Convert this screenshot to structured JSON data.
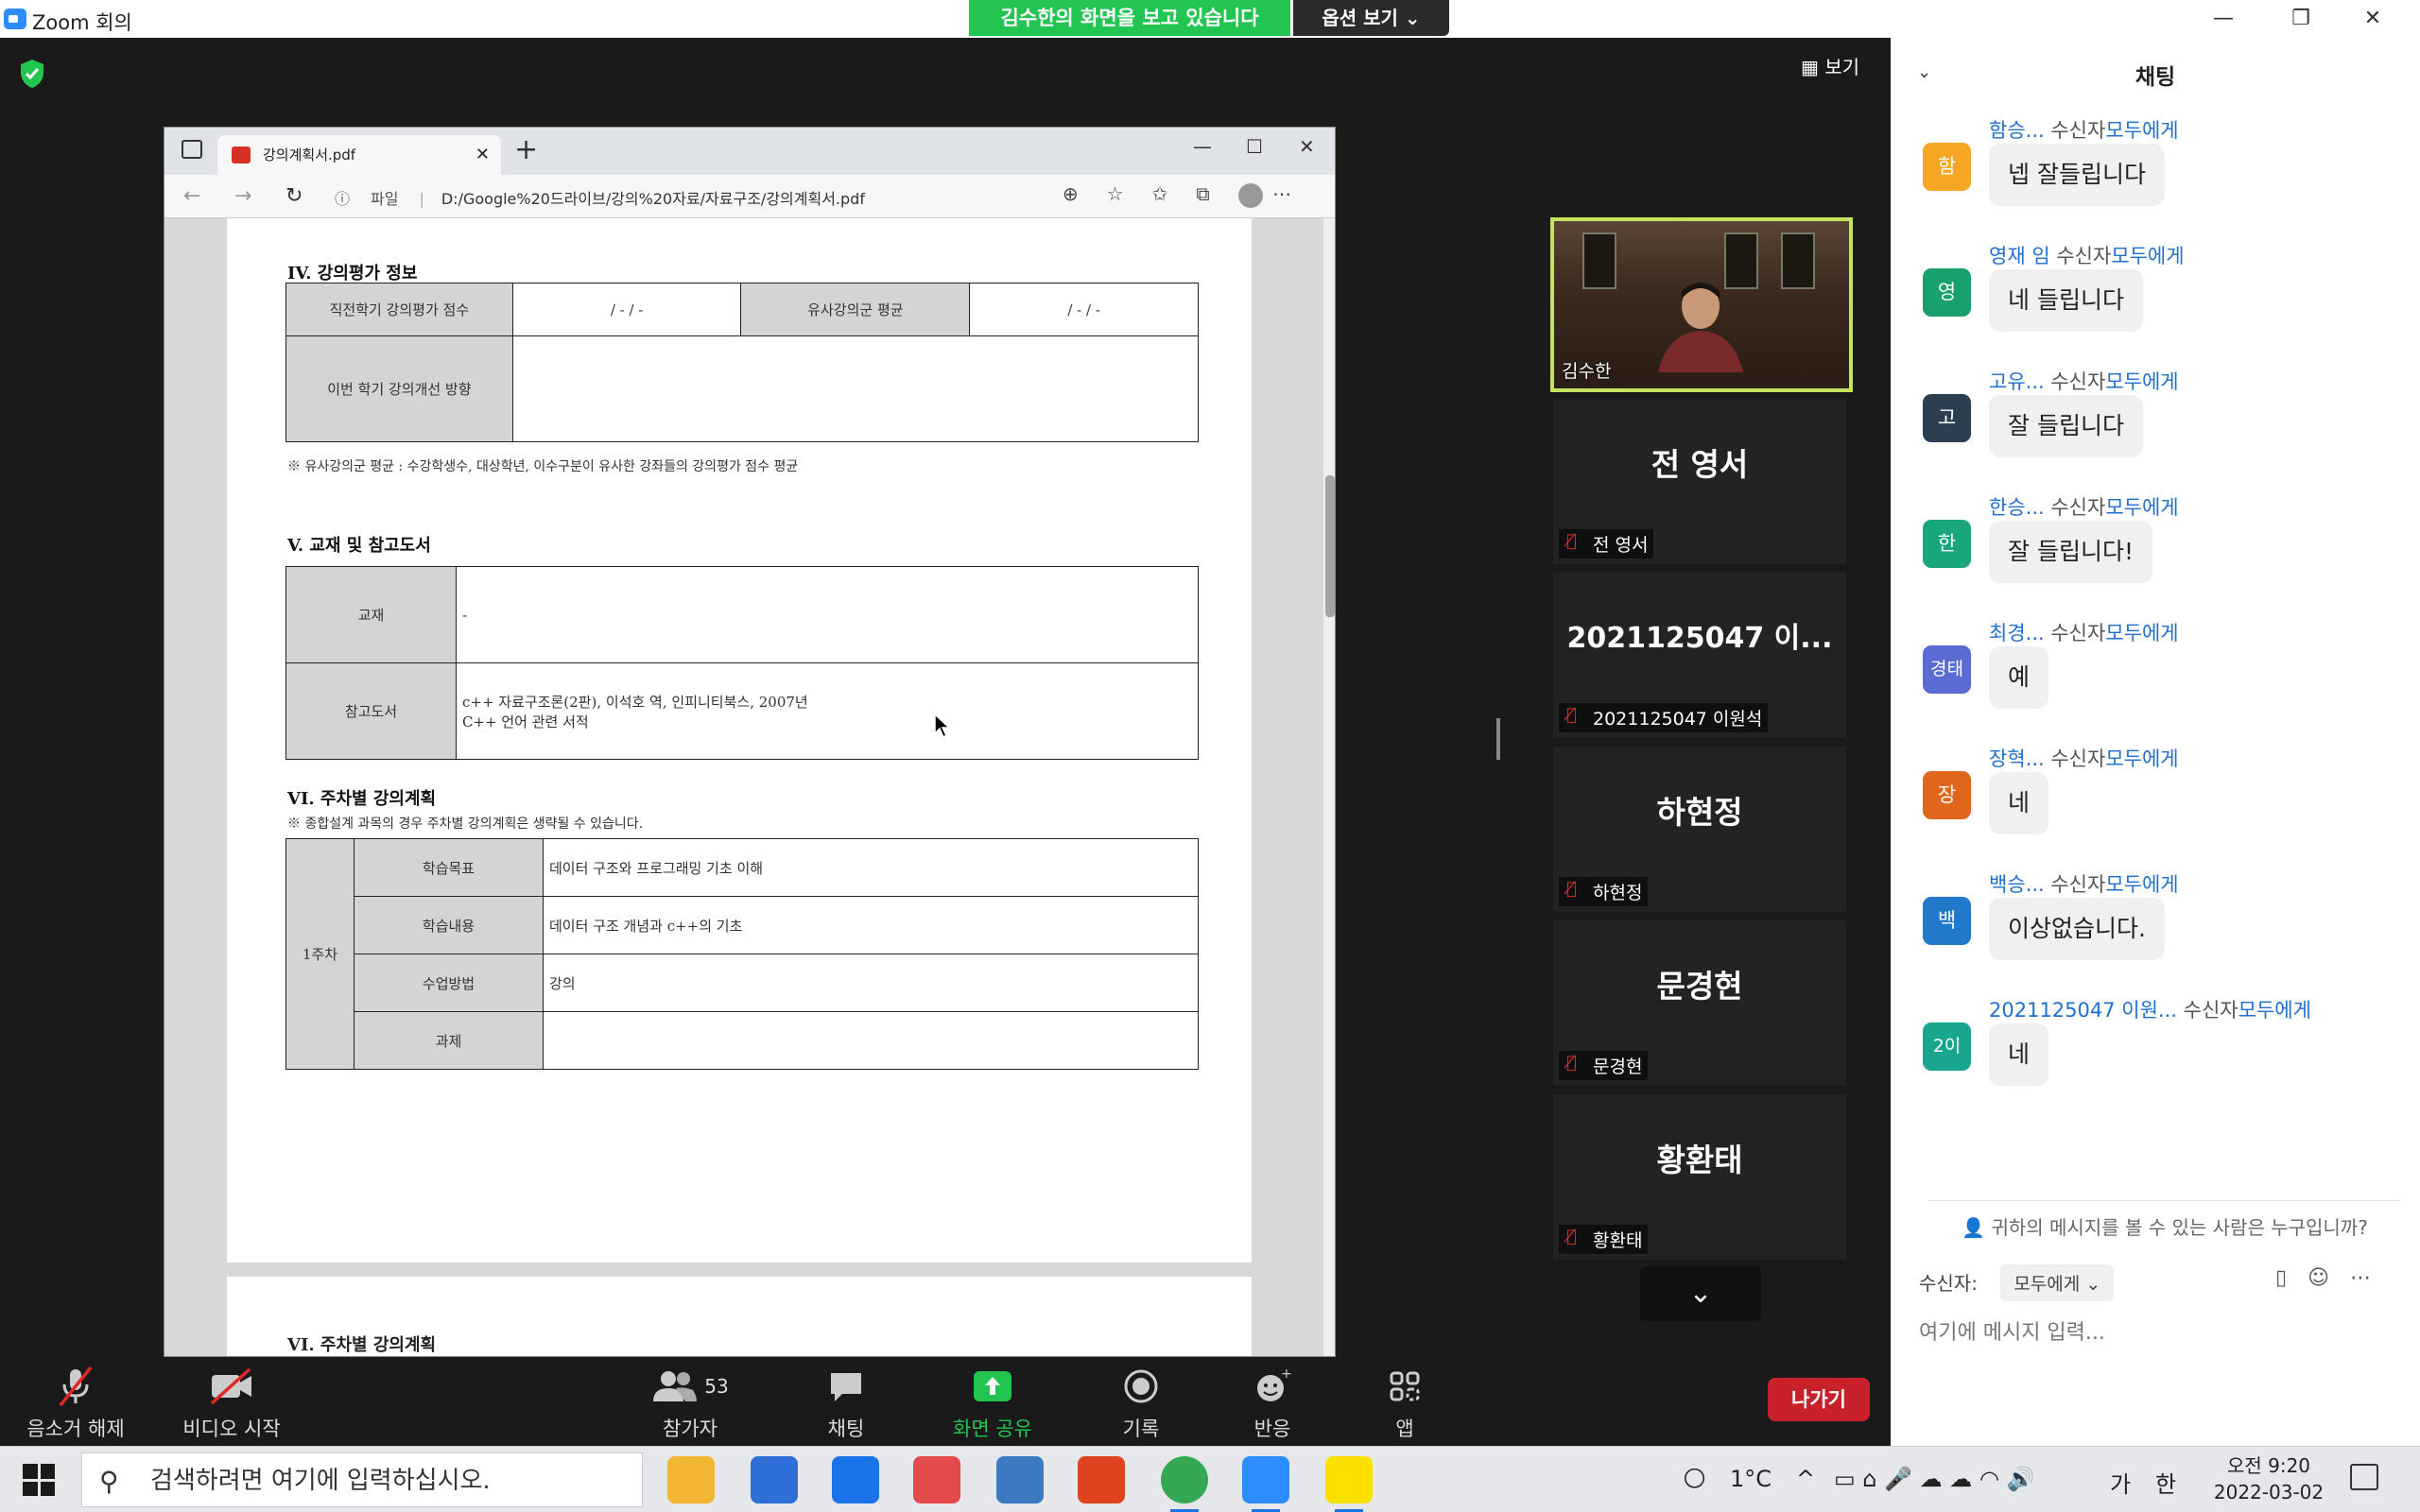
{
  "window": {
    "title": "Zoom 회의",
    "share_banner": "김수한의 화면을 보고 있습니다",
    "view_options": "옵션 보기 ⌄",
    "view_button": "보기",
    "min": "—",
    "restore": "❐",
    "close": "✕"
  },
  "browser": {
    "tab_title": "강의계획서.pdf",
    "scheme": "파일",
    "url": "D:/Google%20드라이브/강의%20자료/자료구조/강의계획서.pdf"
  },
  "document": {
    "sec4_title": "IV. 강의평가 정보",
    "sec4_row1": [
      "직전학기 강의평가 점수",
      "/ - / -",
      "유사강의군 평균",
      "/ - / -"
    ],
    "sec4_row2_label": "이번 학기 강의개선 방향",
    "sec4_note": "※ 유사강의군 평균 : 수강학생수, 대상학년, 이수구분이 유사한 강좌들의 강의평가 점수 평균",
    "sec5_title": "V. 교재 및 참고도서",
    "textbook_label": "교재",
    "textbook_value": "-",
    "reference_label": "참고도서",
    "reference_line1": "c++ 자료구조론(2판), 이석호 역, 인피니티북스, 2007년",
    "reference_line2": "C++ 언어 관련 서적",
    "sec6_title": "VI. 주차별 강의계획",
    "sec6_note": "※ 종합설계 과목의 경우 주차별 강의계획은 생략될 수 있습니다.",
    "week_label": "1주차",
    "week_rows": [
      {
        "label": "학습목표",
        "value": "데이터 구조와 프로그래밍 기초 이해"
      },
      {
        "label": "학습내용",
        "value": "데이터 구조 개념과 c++의 기초"
      },
      {
        "label": "수업방법",
        "value": "강의"
      },
      {
        "label": "과제",
        "value": ""
      }
    ],
    "page2_title": "VI. 주차별 강의계획"
  },
  "participants": {
    "speaker": "김수한",
    "tiles": [
      {
        "big": "전 영서",
        "label": "전 영서"
      },
      {
        "big": "2021125047 이...",
        "label": "2021125047 이원석"
      },
      {
        "big": "하현정",
        "label": "하현정"
      },
      {
        "big": "문경현",
        "label": "문경현"
      },
      {
        "big": "황환태",
        "label": "황환태"
      }
    ]
  },
  "toolbar": {
    "mute": "음소거 해제",
    "video": "비디오 시작",
    "participants": "참가자",
    "participant_count": "53",
    "chat": "채팅",
    "share": "화면 공유",
    "record": "기록",
    "reactions": "반응",
    "apps": "앱",
    "leave": "나가기"
  },
  "chat": {
    "title": "채팅",
    "to_word": "수신자",
    "to_all": "모두에게",
    "messages": [
      {
        "sender": "함승...",
        "avatar": "함",
        "color": "#f5a623",
        "text": "넵 잘들립니다"
      },
      {
        "sender": "영재 임",
        "avatar": "영",
        "color": "#1aa06d",
        "text": "네 들립니다"
      },
      {
        "sender": "고유...",
        "avatar": "고",
        "color": "#2c3e50",
        "text": "잘 들립니다"
      },
      {
        "sender": "한승...",
        "avatar": "한",
        "color": "#19a67a",
        "text": "잘 들립니다!"
      },
      {
        "sender": "최경...",
        "avatar": "경태",
        "color": "#5b6bd4",
        "text": "예"
      },
      {
        "sender": "장혁...",
        "avatar": "장",
        "color": "#e0661b",
        "text": "네"
      },
      {
        "sender": "백승...",
        "avatar": "백",
        "color": "#2379c9",
        "text": "이상없습니다."
      },
      {
        "sender": "2021125047 이원...",
        "avatar": "2이",
        "color": "#1aa68e",
        "text": "네"
      }
    ],
    "who_sees": "귀하의 메시지를 볼 수 있는 사람은 누구입니까?",
    "recipient_label": "수신자:",
    "recipient_value": "모두에게 ⌄",
    "input_placeholder": "여기에 메시지 입력..."
  },
  "taskbar": {
    "search_placeholder": "검색하려면 여기에 입력하십시오.",
    "weather": "1°C",
    "lang": "가",
    "ime": "한",
    "time": "오전 9:20",
    "date": "2022-03-02"
  }
}
